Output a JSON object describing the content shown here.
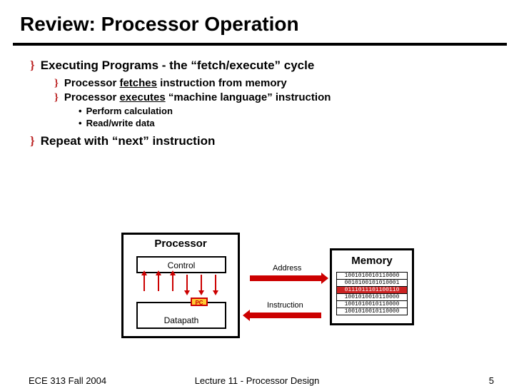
{
  "title": "Review: Processor Operation",
  "bullets": {
    "l1a": "Executing Programs - the “fetch/execute” cycle",
    "l2a_pre": "Processor ",
    "l2a_u": "fetches",
    "l2a_post": " instruction from memory",
    "l2b_pre": "Processor ",
    "l2b_u": "executes",
    "l2b_post": " “machine language” instruction",
    "l3a": "Perform calculation",
    "l3b": "Read/write data",
    "l1b": "Repeat with “next” instruction"
  },
  "diagram": {
    "processor": "Processor",
    "control": "Control",
    "datapath": "Datapath",
    "pc": "PC",
    "memory": "Memory",
    "address": "Address",
    "instruction": "Instruction",
    "mem_rows": [
      "1001010010110000",
      "0010100101010001",
      "0111011101100110",
      "1001010010110000",
      "1001010010110000",
      "1001010010110000"
    ],
    "mem_hl_index": 2
  },
  "footer": {
    "left": "ECE 313 Fall 2004",
    "center": "Lecture 11 - Processor Design",
    "right": "5"
  }
}
